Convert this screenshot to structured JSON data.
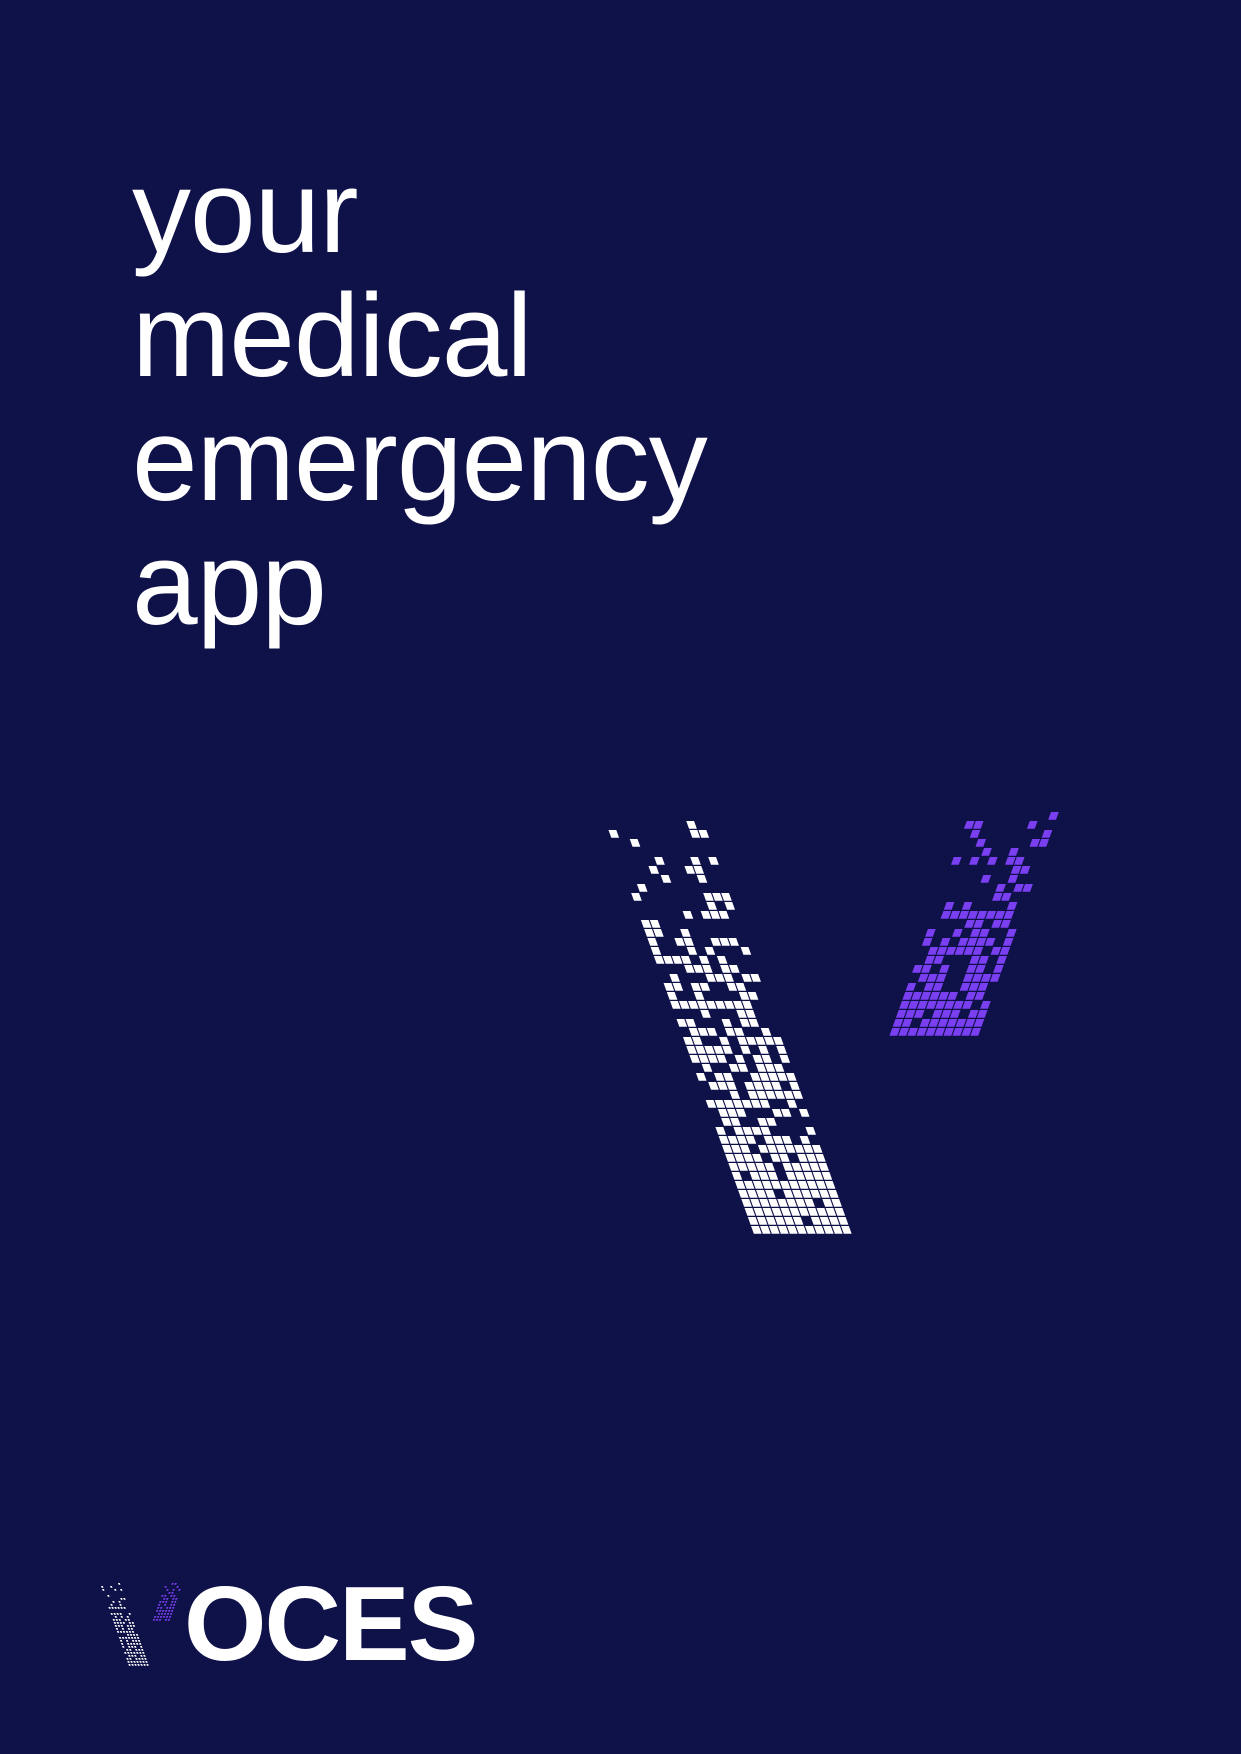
{
  "headline": {
    "lines": [
      "your",
      "medical",
      "emergency",
      "app"
    ]
  },
  "brand": {
    "wordmark_rest": "OCES",
    "primary_color": "#0f1149",
    "accent_color": "#7b3ff2",
    "text_color": "#ffffff"
  },
  "icons": {
    "main_mark": "pixelated-v-logo-icon",
    "logo_mark": "pixelated-v-small-icon"
  }
}
